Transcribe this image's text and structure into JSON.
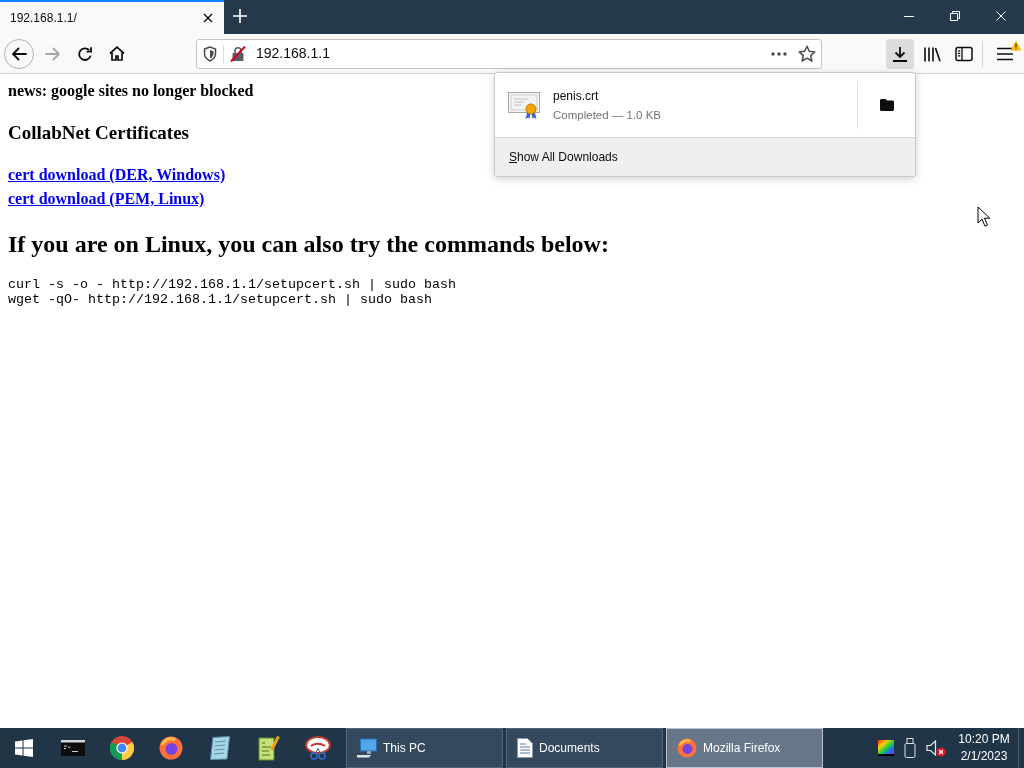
{
  "tabs": [
    {
      "title": "192.168.1.1/",
      "selected": true
    }
  ],
  "nav_buttons": [
    {
      "kind": "back",
      "disabled": false
    },
    {
      "kind": "forward",
      "disabled": true
    },
    {
      "kind": "reload",
      "disabled": false
    },
    {
      "kind": "home",
      "disabled": false
    }
  ],
  "address_bar": {
    "url": "192.168.1.1",
    "insecure": true
  },
  "downloads_button": {
    "pressed": true
  },
  "menu_button": {
    "warning": true
  },
  "page": {
    "news": "news: google sites no longer blocked",
    "title": "CollabNet Certificates",
    "links": [
      "cert download (DER, Windows)",
      "cert download (PEM, Linux)"
    ],
    "heading": "If you are on Linux, you can also try the commands below:",
    "commands": [
      "curl -s -o - http://192.168.1.1/setupcert.sh | sudo bash",
      "wget -qO- http://192.168.1.1/setupcert.sh | sudo bash"
    ]
  },
  "downloads_panel": {
    "items": [
      {
        "filename": "penis.crt",
        "status": "Completed — 1.0 KB"
      }
    ],
    "footer": "Show All Downloads"
  },
  "taskbar": {
    "windows": [
      {
        "label": "This PC",
        "selected": false
      },
      {
        "label": "Documents",
        "selected": false
      },
      {
        "label": "Mozilla Firefox",
        "selected": true
      }
    ],
    "tray": {
      "muted": true
    },
    "clock": {
      "time": "10:20 PM",
      "date": "2/1/2023"
    }
  }
}
